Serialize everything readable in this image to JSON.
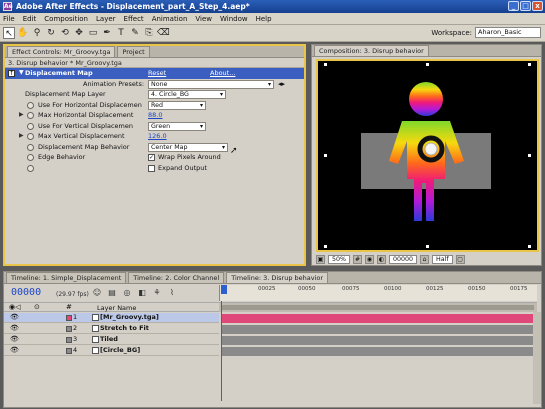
{
  "window": {
    "title": "Adobe After Effects - Displacement_part_A_Step_4.aep*",
    "controls": [
      "_",
      "□",
      "x"
    ]
  },
  "menu": [
    "File",
    "Edit",
    "Composition",
    "Layer",
    "Effect",
    "Animation",
    "View",
    "Window",
    "Help"
  ],
  "toolbar": {
    "workspace_label": "Workspace:",
    "workspace_value": "Aharon_Basic"
  },
  "effect_controls": {
    "tab_label": "Effect Controls: Mr_Groovy.tga",
    "project_tab": "Project",
    "header": "3. Disrup behavior * Mr_Groovy.tga",
    "effect_name": "Displacement Map",
    "reset": "Reset",
    "about": "About...",
    "animation_presets_label": "Animation Presets:",
    "animation_presets_value": "None",
    "rows": {
      "map_layer": {
        "label": "Displacement Map Layer",
        "value": "4. Circle_BG"
      },
      "use_h": {
        "label": "Use For Horizontal Displacemen",
        "value": "Red"
      },
      "max_h": {
        "label": "Max Horizontal Displacement",
        "value": "88.0"
      },
      "use_v": {
        "label": "Use For Vertical Displacemen",
        "value": "Green"
      },
      "max_v": {
        "label": "Max Vertical Displacement",
        "value": "126.0"
      },
      "map_behavior": {
        "label": "Displacement Map Behavior",
        "value": "Center Map"
      },
      "edge_behavior": {
        "label": "Edge Behavior",
        "value": "Wrap Pixels Around"
      },
      "expand_output": {
        "label": "Expand Output"
      }
    }
  },
  "composition": {
    "tab_label": "Composition: 3. Disrup behavior",
    "zoom": "50%",
    "timecode": "00000",
    "resolution": "Half"
  },
  "timeline": {
    "tabs": [
      "Timeline: 1. Simple_Displacement",
      "Timeline: 2. Color Channel",
      "Timeline: 3. Disrup behavior"
    ],
    "current_time": "00000",
    "fps": "(29.97 fps)",
    "layer_name_header": "Layer Name",
    "ruler_ticks": [
      "00025",
      "00050",
      "00075",
      "00100",
      "00125",
      "00150",
      "00175"
    ],
    "layers": [
      {
        "num": "1",
        "name": "[Mr_Groovy.tga]",
        "color": "#e0487a",
        "selected": true
      },
      {
        "num": "2",
        "name": "Stretch to Fit",
        "color": "#8a8a8a",
        "selected": false
      },
      {
        "num": "3",
        "name": "Tiled",
        "color": "#8a8a8a",
        "selected": false
      },
      {
        "num": "4",
        "name": "[Circle_BG]",
        "color": "#8a8a8a",
        "selected": false
      }
    ]
  },
  "colors": {
    "accent_highlight": "#e8c548",
    "effect_header": "#3b5fc0",
    "timecode_blue": "#1d46c8"
  }
}
